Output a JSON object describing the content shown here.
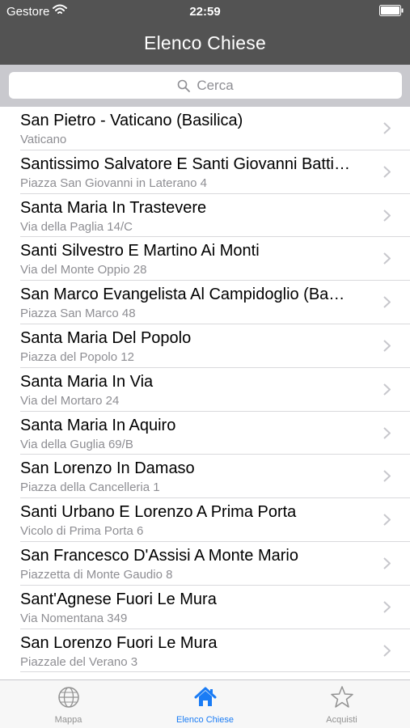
{
  "status_bar": {
    "carrier": "Gestore",
    "time": "22:59"
  },
  "nav": {
    "title": "Elenco Chiese"
  },
  "search": {
    "placeholder": "Cerca"
  },
  "churches": [
    {
      "name": "San Pietro - Vaticano (Basilica)",
      "address": "Vaticano"
    },
    {
      "name": "Santissimo Salvatore E Santi Giovanni Batti…",
      "address": "Piazza San Giovanni in Laterano 4"
    },
    {
      "name": "Santa Maria In Trastevere",
      "address": "Via della Paglia 14/C"
    },
    {
      "name": "Santi Silvestro E Martino Ai Monti",
      "address": "Via del Monte Oppio 28"
    },
    {
      "name": "San Marco Evangelista Al Campidoglio (Ba…",
      "address": "Piazza San Marco 48"
    },
    {
      "name": "Santa Maria Del Popolo",
      "address": "Piazza del Popolo 12"
    },
    {
      "name": "Santa Maria In Via",
      "address": "Via del Mortaro 24"
    },
    {
      "name": "Santa Maria In Aquiro",
      "address": "Via della Guglia 69/B"
    },
    {
      "name": "San Lorenzo In Damaso",
      "address": "Piazza della Cancelleria 1"
    },
    {
      "name": "Santi Urbano E Lorenzo A Prima Porta",
      "address": "Vicolo di Prima Porta 6"
    },
    {
      "name": "San Francesco D'Assisi A Monte Mario",
      "address": "Piazzetta di Monte Gaudio 8"
    },
    {
      "name": "Sant'Agnese Fuori Le Mura",
      "address": "Via Nomentana 349"
    },
    {
      "name": "San Lorenzo Fuori Le Mura",
      "address": "Piazzale del Verano 3"
    }
  ],
  "tabs": [
    {
      "label": "Mappa",
      "icon": "globe-icon",
      "active": false
    },
    {
      "label": "Elenco Chiese",
      "icon": "home-icon",
      "active": true
    },
    {
      "label": "Acquisti",
      "icon": "star-icon",
      "active": false
    }
  ],
  "colors": {
    "nav_background": "#535353",
    "active_tab": "#1a7cf5",
    "inactive_tab": "#929292"
  }
}
